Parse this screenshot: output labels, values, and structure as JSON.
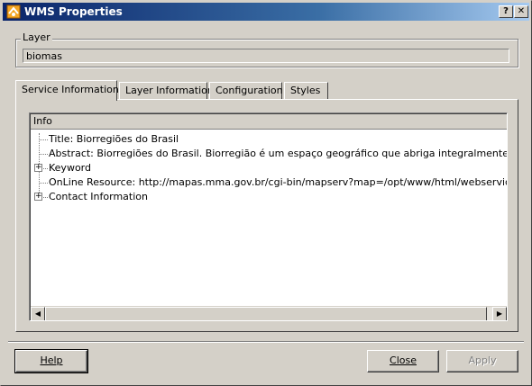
{
  "window": {
    "title": "WMS Properties",
    "help_glyph": "?",
    "close_glyph": "✕"
  },
  "layer": {
    "legend": "Layer",
    "value": "biomas"
  },
  "tabs": [
    {
      "label": "Service Information",
      "active": true
    },
    {
      "label": "Layer Information",
      "active": false
    },
    {
      "label": "Configuration",
      "active": false
    },
    {
      "label": "Styles",
      "active": false
    }
  ],
  "tree": {
    "column_header": "Info",
    "rows": [
      {
        "label": "Title: Biorregiões do Brasil",
        "expandable": false
      },
      {
        "label": "Abstract: Biorregiões do Brasil. Biorregião é um espaço geográfico que abriga integralmente um ou vários ec",
        "expandable": false
      },
      {
        "label": "Keyword",
        "expandable": true
      },
      {
        "label": "OnLine Resource: http://mapas.mma.gov.br/cgi-bin/mapserv?map=/opt/www/html/webservices/biorregioe",
        "expandable": false
      },
      {
        "label": "Contact Information",
        "expandable": true
      }
    ],
    "expand_glyph": "+"
  },
  "scrollbar": {
    "left_arrow": "◀",
    "right_arrow": "▶"
  },
  "buttons": {
    "help": "Help",
    "close": "Close",
    "apply": "Apply"
  },
  "colors": {
    "titlebar_start": "#0a246a",
    "titlebar_end": "#a6caf0",
    "face": "#d4d0c8"
  },
  "icons": {
    "app": "qgis-icon"
  }
}
